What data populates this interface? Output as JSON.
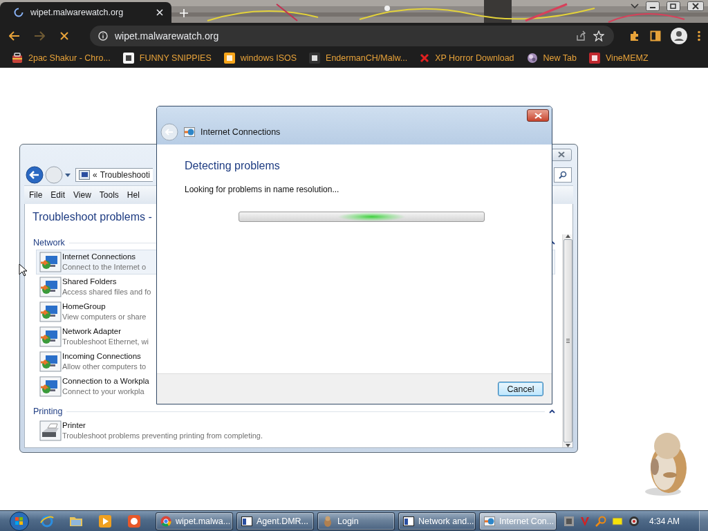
{
  "browser": {
    "loading": true,
    "tabs": [
      {
        "title": "wipet.malwarewatch.org",
        "selected": true
      }
    ],
    "address": "wipet.malwarewatch.org",
    "bookmarks": [
      {
        "label": "2pac Shakur - Chro..."
      },
      {
        "label": "FUNNY SNIPPIES"
      },
      {
        "label": "windows ISOS"
      },
      {
        "label": "EndermanCH/Malw..."
      },
      {
        "label": "XP Horror Download"
      },
      {
        "label": "New Tab"
      },
      {
        "label": "VineMEMZ"
      }
    ]
  },
  "explorer": {
    "address_separator": "«",
    "address": "Troubleshooti",
    "menu": [
      "File",
      "Edit",
      "View",
      "Tools",
      "Hel"
    ],
    "heading": "Troubleshoot problems -",
    "sections": [
      {
        "title": "Network",
        "expanded": true,
        "items": [
          {
            "title": "Internet Connections",
            "description": "Connect to the Internet o",
            "selected": true
          },
          {
            "title": "Shared Folders",
            "description": "Access shared files and fo",
            "selected": false
          },
          {
            "title": "HomeGroup",
            "description": "View computers or share",
            "selected": false
          },
          {
            "title": "Network Adapter",
            "description": "Troubleshoot Ethernet, wi",
            "selected": false
          },
          {
            "title": "Incoming Connections",
            "description": "Allow other computers to",
            "selected": false
          },
          {
            "title": "Connection to a Workpla",
            "description": "Connect to your workpla",
            "selected": false
          }
        ]
      },
      {
        "title": "Printing",
        "expanded": true,
        "items": [
          {
            "title": "Printer",
            "description": "Troubleshoot problems preventing printing from completing.",
            "selected": false
          }
        ]
      }
    ]
  },
  "dialog": {
    "title": "Internet Connections",
    "heading": "Detecting problems",
    "status": "Looking for problems in name resolution...",
    "progress": {
      "indeterminate": true
    },
    "button": "Cancel"
  },
  "taskbar": {
    "tasks": [
      {
        "label": "wipet.malwa...",
        "selected": false
      },
      {
        "label": "Agent.DMR...",
        "selected": false
      },
      {
        "label": "Login",
        "selected": false
      },
      {
        "label": "Network and...",
        "selected": false
      },
      {
        "label": "Internet Con...",
        "selected": true
      }
    ],
    "clock": "4:34 AM"
  }
}
